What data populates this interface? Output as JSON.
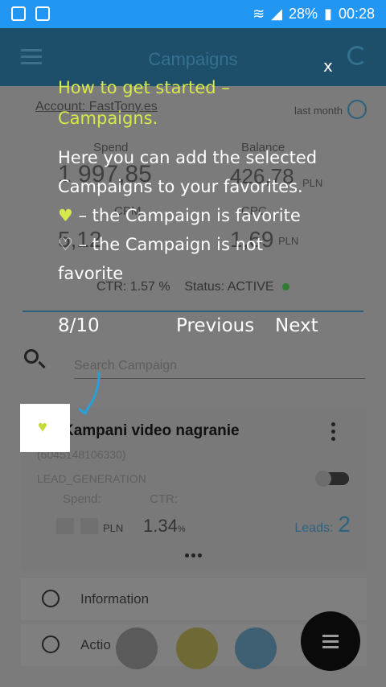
{
  "status_bar": {
    "battery": "28%",
    "time": "00:28"
  },
  "app_bar": {
    "title": "Campaigns"
  },
  "account": {
    "prefix": "Account: ",
    "name": "FastTony.es",
    "period": "last month"
  },
  "summary": {
    "spend_label": "Spend",
    "spend_value": "1 997,85",
    "balance_label": "Balance",
    "balance_value": "426,78",
    "balance_currency": "PLN",
    "cpm_label": "CPM",
    "cpm_value": "5,12",
    "cpc_label": "CPC",
    "cpc_value": "1,69",
    "cpc_currency": "PLN",
    "ctr_text": "CTR: 1.57 %",
    "status_text": "Status: ACTIVE"
  },
  "search": {
    "placeholder": "Search Campaign"
  },
  "campaign": {
    "name": "Kampani video nagranie",
    "id": "(6045148106330)",
    "objective": "LEAD_GENERATION",
    "spend_label": "Spend:",
    "ctr_label": "CTR:",
    "spend_currency": "PLN",
    "ctr_value": "1.34",
    "ctr_unit": "%",
    "leads_label": "Leads:",
    "leads_value": "2"
  },
  "rows": {
    "information": "Information",
    "actions": "Actio"
  },
  "tutorial": {
    "close": "x",
    "title": "How to get started – Campaigns.",
    "line1": "Here you can add the selected Campaigns to your favorites.",
    "line2": " – the Campaign is favorite",
    "line3": " – the Campaign is not favorite",
    "step": "8/10",
    "previous": "Previous",
    "next": "Next"
  },
  "colors": {
    "accent": "#2196f3",
    "favorite": "#d7e84a",
    "overlay_dark": "#1d4f6a"
  }
}
